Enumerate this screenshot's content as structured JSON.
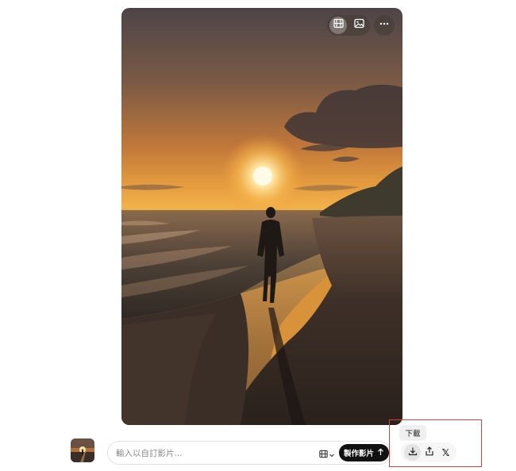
{
  "image": {
    "icons": {
      "video_mode": "film-icon",
      "image_mode": "image-icon",
      "more": "more-horizontal-icon"
    }
  },
  "composer": {
    "thumbnail": "sunset-beach-thumbnail",
    "placeholder": "輸入以自訂影片...",
    "mode_icon": "film-icon",
    "submit_label": "製作影片",
    "submit_icon": "arrow-up-icon"
  },
  "actions": {
    "tooltip": "下載",
    "download_icon": "download-icon",
    "share_icon": "share-icon",
    "x_label": "𝕏"
  },
  "colors": {
    "highlight": "#d9413f",
    "submit_bg": "#111111"
  }
}
